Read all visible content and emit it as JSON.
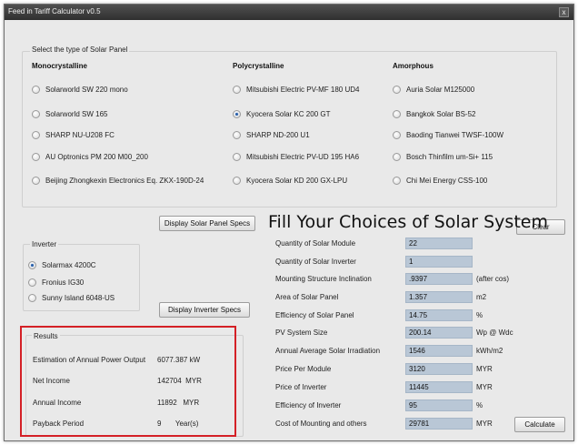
{
  "window": {
    "title": "Feed in Tariff Calculator v0.5",
    "close_glyph": "x"
  },
  "panel_group": {
    "label": "Select the type of Solar Panel",
    "columns": [
      {
        "heading": "Monocrystalline",
        "options": [
          "Solarworld SW 220 mono",
          "Solarworld SW 165",
          "SHARP NU-U208 FC",
          "AU Optronics PM 200 M00_200",
          "Beijing Zhongkexin Electronics Eq. ZKX-190D-24"
        ]
      },
      {
        "heading": "Polycrystalline",
        "options": [
          "Mitsubishi Electric PV-MF 180 UD4",
          "Kyocera Solar KC 200 GT",
          "SHARP ND-200 U1",
          "Mitsubishi Electric PV-UD 195 HA6",
          "Kyocera Solar KD 200 GX-LPU"
        ]
      },
      {
        "heading": "Amorphous",
        "options": [
          "Auria Solar M125000",
          "Bangkok Solar BS-52",
          "Baoding Tianwei TWSF-100W",
          "Bosch Thinfilm um-Si+ 115",
          "Chi Mei Energy CSS-100"
        ]
      }
    ],
    "selected": "Kyocera Solar KC 200 GT"
  },
  "buttons": {
    "display_panel_specs": "Display Solar Panel Specs",
    "display_inverter_specs": "Display Inverter Specs",
    "clear": "Clear",
    "calculate": "Calculate"
  },
  "inverter_group": {
    "label": "Inverter",
    "options": [
      "Solarmax 4200C",
      "Fronius IG30",
      "Sunny Island 6048-US"
    ],
    "selected": "Solarmax 4200C"
  },
  "form": {
    "title": "Fill Your Choices of Solar System",
    "rows": [
      {
        "label": "Quantity of Solar Module",
        "value": "22",
        "unit": ""
      },
      {
        "label": "Quantity of Solar Inverter",
        "value": "1",
        "unit": ""
      },
      {
        "label": "Mounting Structure Inclination",
        "value": ".9397",
        "unit": "(after cos)"
      },
      {
        "label": "Area of Solar Panel",
        "value": "1.357",
        "unit": "m2"
      },
      {
        "label": "Efficiency of Solar Panel",
        "value": "14.75",
        "unit": "%"
      },
      {
        "label": "PV System Size",
        "value": "200.14",
        "unit": "Wp @ Wdc"
      },
      {
        "label": "Annual Average Solar Irradiation",
        "value": "1546",
        "unit": "kWh/m2"
      },
      {
        "label": "Price Per Module",
        "value": "3120",
        "unit": "MYR"
      },
      {
        "label": "Price of Inverter",
        "value": "11445",
        "unit": "MYR"
      },
      {
        "label": "Efficiency of Inverter",
        "value": "95",
        "unit": "%"
      },
      {
        "label": "Cost of Mounting and others",
        "value": "29781",
        "unit": "MYR"
      }
    ]
  },
  "results": {
    "label": "Results",
    "rows": [
      {
        "label": "Estimation of Annual Power Output",
        "value": "6077.387 kW"
      },
      {
        "label": "Net Income",
        "value": "142704  MYR"
      },
      {
        "label": "Annual Income",
        "value": "11892   MYR"
      },
      {
        "label": "Payback Period",
        "value": "9       Year(s)"
      }
    ]
  },
  "colors": {
    "field_bg": "#b9c7d6",
    "highlight_border": "#d42026",
    "radio_selected": "#2a5fa8"
  }
}
